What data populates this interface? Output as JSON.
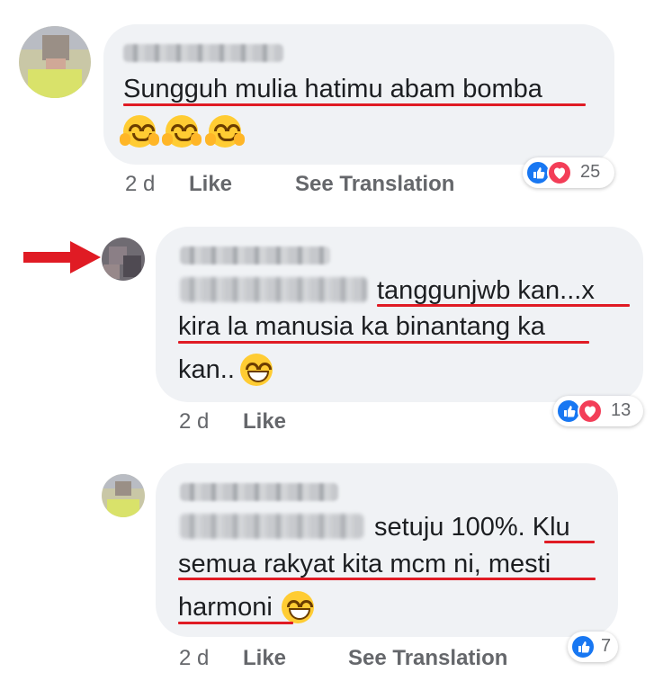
{
  "comments": [
    {
      "message": "Sungguh mulia hatimu abam bomba",
      "emojis": [
        "hugging-face",
        "hugging-face",
        "hugging-face"
      ],
      "time": "2 d",
      "like_label": "Like",
      "translate_label": "See Translation",
      "reaction_count": "25",
      "reactions": [
        "like",
        "love"
      ]
    },
    {
      "line1_text": "tanggunjwb kan...x",
      "line2_text": "kira la manusia ka  binantang ka",
      "line3_text": "kan..",
      "emoji": "grinning-face",
      "time": "2 d",
      "like_label": "Like",
      "reaction_count": "13",
      "reactions": [
        "like",
        "love"
      ]
    },
    {
      "line1_text": "setuju 100%. Klu",
      "line2_text": "semua rakyat kita mcm ni, mesti",
      "line3_text": "harmoni",
      "emoji": "grinning-face",
      "time": "2 d",
      "like_label": "Like",
      "translate_label": "See Translation",
      "reaction_count": "7",
      "reactions": [
        "like"
      ]
    }
  ],
  "colors": {
    "bubble": "#f0f2f5",
    "underline": "#e01b24",
    "arrow": "#e01b24",
    "like_blue": "#1877f2",
    "love_red": "#f33e58",
    "meta_gray": "#65676b"
  }
}
